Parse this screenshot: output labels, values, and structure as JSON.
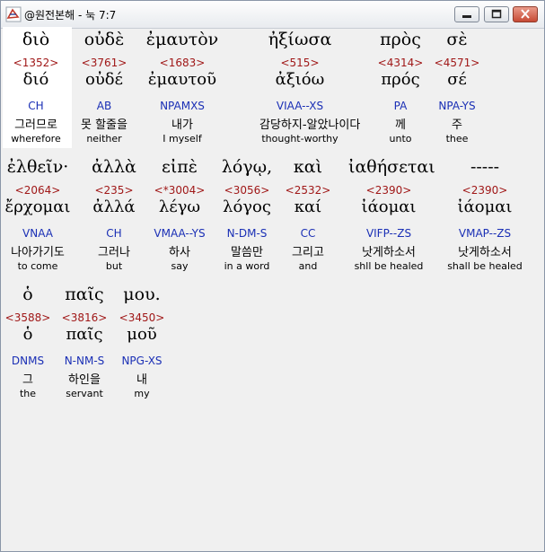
{
  "window": {
    "title": "@원전본해 - 눅 7:7"
  },
  "rows": [
    [
      {
        "greek": "διὸ",
        "strong": "<1352>",
        "lemma": "διό",
        "parse": "CH",
        "korean": "그러므로",
        "english": "wherefore"
      },
      {
        "greek": "οὐδὲ",
        "strong": "<3761>",
        "lemma": "οὐδέ",
        "parse": "AB",
        "korean": "못 할줄을",
        "english": "neither"
      },
      {
        "greek": "ἐμαυτὸν",
        "strong": "<1683>",
        "lemma": "ἐμαυτοῦ",
        "parse": "NPAMXS",
        "korean": "내가",
        "english": "I myself"
      },
      {
        "greek": "ἠξίωσα",
        "strong": "<515>",
        "lemma": "ἀξιόω",
        "parse": "VIAA--XS",
        "korean": "감당하지-알았나이다",
        "english": "thought-worthy"
      },
      {
        "greek": "πρὸς",
        "strong": "<4314>",
        "lemma": "πρός",
        "parse": "PA",
        "korean": "께",
        "english": "unto"
      },
      {
        "greek": "σὲ",
        "strong": "<4571>",
        "lemma": "σέ",
        "parse": "NPA-YS",
        "korean": "주",
        "english": "thee"
      }
    ],
    [
      {
        "greek": "ἐλθεῖν·",
        "strong": "<2064>",
        "lemma": "ἔρχομαι",
        "parse": "VNAA",
        "korean": "나아가기도",
        "english": "to come"
      },
      {
        "greek": "ἀλλὰ",
        "strong": "<235>",
        "lemma": "ἀλλά",
        "parse": "CH",
        "korean": "그러나",
        "english": "but"
      },
      {
        "greek": "εἰπὲ",
        "strong": "<*3004>",
        "lemma": "λέγω",
        "parse": "VMAA--YS",
        "korean": "하사",
        "english": "say"
      },
      {
        "greek": "λόγῳ,",
        "strong": "<3056>",
        "lemma": "λόγος",
        "parse": "N-DM-S",
        "korean": "말씀만",
        "english": "in a word"
      },
      {
        "greek": "καὶ",
        "strong": "<2532>",
        "lemma": "καί",
        "parse": "CC",
        "korean": "그리고",
        "english": "and"
      },
      {
        "greek": "ἰαθήσεται",
        "strong": "<2390>",
        "lemma": "ἰάομαι",
        "parse": "VIFP--ZS",
        "korean": "낫게하소서",
        "english": "shll be healed"
      },
      {
        "greek": "-----",
        "strong": "<2390>",
        "lemma": "ἰάομαι",
        "parse": "VMAP--ZS",
        "korean": "낫게하소서",
        "english": "shall be healed"
      }
    ],
    [
      {
        "greek": "ὁ",
        "strong": "<3588>",
        "lemma": "ὁ",
        "parse": "DNMS",
        "korean": "그",
        "english": "the"
      },
      {
        "greek": "παῖς",
        "strong": "<3816>",
        "lemma": "παῖς",
        "parse": "N-NM-S",
        "korean": "하인을",
        "english": "servant"
      },
      {
        "greek": "μου.",
        "strong": "<3450>",
        "lemma": "μοῦ",
        "parse": "NPG-XS",
        "korean": "내",
        "english": "my"
      }
    ]
  ]
}
